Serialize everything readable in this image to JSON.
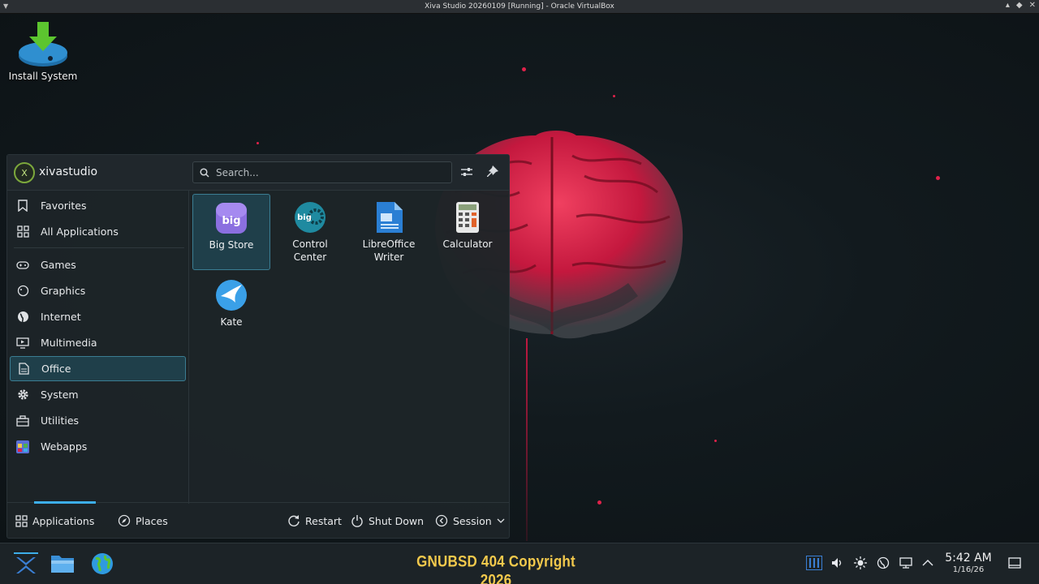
{
  "window_title": "Xiva Studio 20260109 [Running] - Oracle VirtualBox",
  "desktop": {
    "install_icon_label": "Install System"
  },
  "launcher": {
    "avatar_initial": "X",
    "username": "xivastudio",
    "search_placeholder": "Search...",
    "categories": [
      {
        "label": "Favorites",
        "icon": "bookmark-icon",
        "selected": false
      },
      {
        "label": "All Applications",
        "icon": "grid-icon",
        "selected": false
      },
      {
        "label": "Games",
        "icon": "gamepad-icon",
        "selected": false
      },
      {
        "label": "Graphics",
        "icon": "palette-icon",
        "selected": false
      },
      {
        "label": "Internet",
        "icon": "globe-icon",
        "selected": false
      },
      {
        "label": "Multimedia",
        "icon": "monitor-play-icon",
        "selected": false
      },
      {
        "label": "Office",
        "icon": "document-icon",
        "selected": true
      },
      {
        "label": "System",
        "icon": "gear-icon",
        "selected": false
      },
      {
        "label": "Utilities",
        "icon": "toolbox-icon",
        "selected": false
      },
      {
        "label": "Webapps",
        "icon": "webapps-icon",
        "selected": false
      }
    ],
    "apps": [
      {
        "name": "Big Store",
        "icon": "big-store-icon",
        "selected": true
      },
      {
        "name": "Control\nCenter",
        "icon": "control-center-icon",
        "selected": false
      },
      {
        "name": "LibreOffice\nWriter",
        "icon": "libreoffice-writer-icon",
        "selected": false
      },
      {
        "name": "Calculator",
        "icon": "calculator-icon",
        "selected": false
      },
      {
        "name": "Kate",
        "icon": "kate-icon",
        "selected": false
      }
    ],
    "footer": {
      "applications": "Applications",
      "places": "Places",
      "restart": "Restart",
      "shutdown": "Shut Down",
      "session": "Session"
    }
  },
  "taskbar": {
    "copyright": "GNUBSD 404 Copyright 2026",
    "time": "5:42 AM",
    "date": "1/16/26"
  },
  "colors": {
    "accent": "#3daee9",
    "selection_bg": "#1f3f4a",
    "brain_red": "#e0224a",
    "copyright_yellow": "#f2c94c"
  }
}
